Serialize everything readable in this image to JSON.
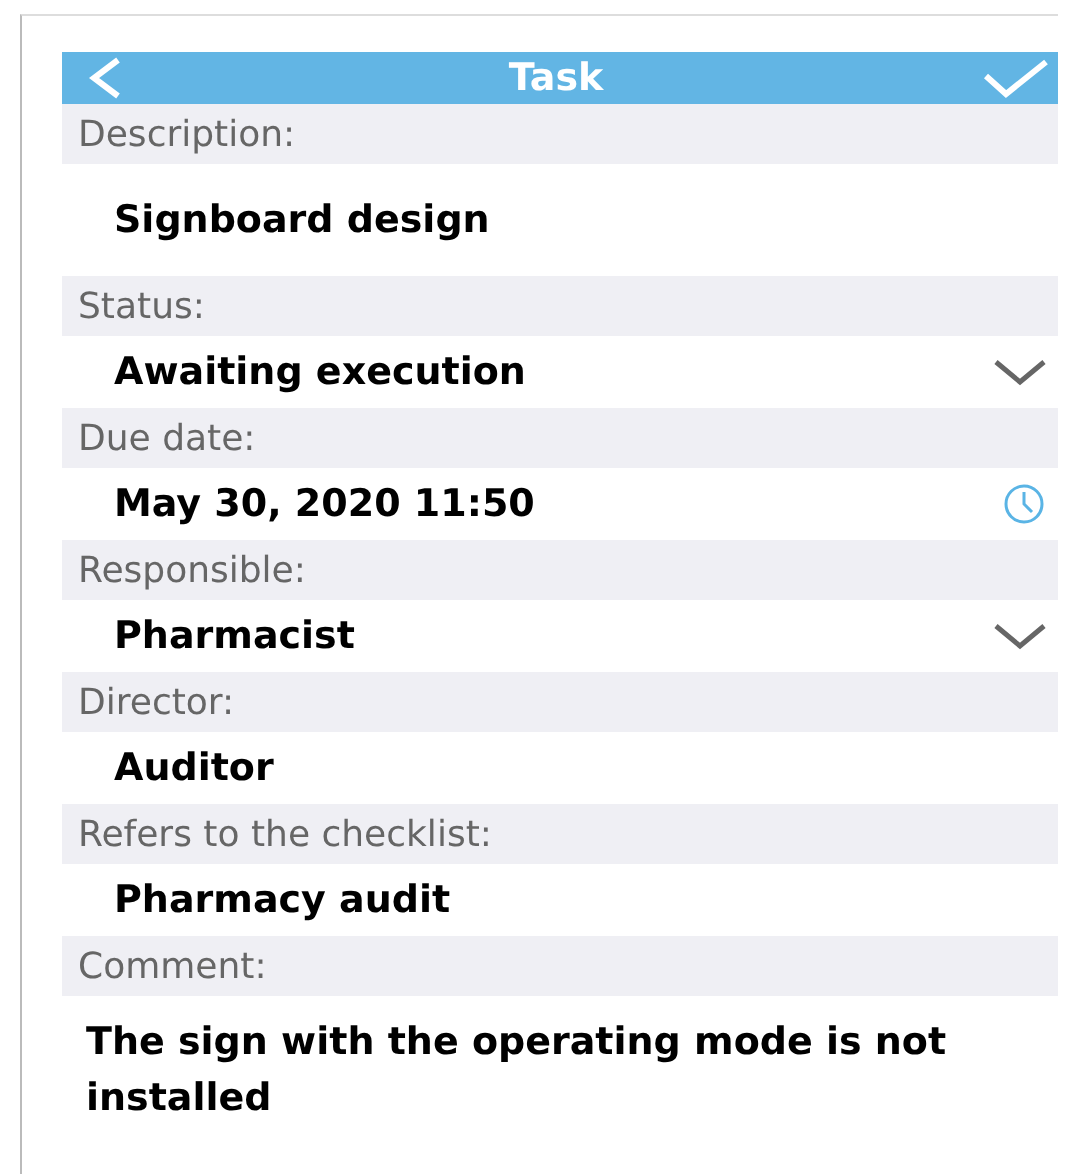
{
  "header": {
    "title": "Task"
  },
  "fields": [
    {
      "label": "Description:",
      "value": "Signboard design",
      "kind": "text"
    },
    {
      "label": "Status:",
      "value": "Awaiting execution",
      "kind": "select"
    },
    {
      "label": "Due date:",
      "value": "May 30, 2020 11:50",
      "kind": "datetime"
    },
    {
      "label": "Responsible:",
      "value": "Pharmacist",
      "kind": "select"
    },
    {
      "label": "Director:",
      "value": "Auditor",
      "kind": "text"
    },
    {
      "label": "Refers to the checklist:",
      "value": "Pharmacy audit",
      "kind": "text"
    },
    {
      "label": "Comment:",
      "value": "The sign with the operating mode is not installed",
      "kind": "text"
    }
  ]
}
